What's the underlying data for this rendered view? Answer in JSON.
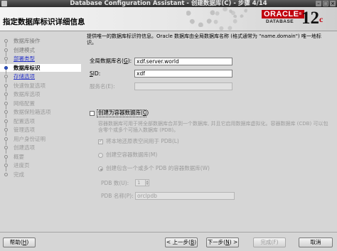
{
  "window": {
    "title": "Database Configuration Assistant - 创建数据库(C) - 步骤 4/14"
  },
  "header": {
    "page_title": "指定数据库标识详细信息",
    "brand_word": "ORACLE",
    "brand_registered": "®",
    "brand_sub": "DATABASE",
    "version_number": "12",
    "version_suffix": "c"
  },
  "steps": [
    {
      "label": "数据库操作",
      "state": "done"
    },
    {
      "label": "创建模式",
      "state": "done"
    },
    {
      "label": "部署类型",
      "state": "link"
    },
    {
      "label": "数据库标识",
      "state": "current"
    },
    {
      "label": "存储选项",
      "state": "link"
    },
    {
      "label": "快速恢复选项",
      "state": "pending"
    },
    {
      "label": "数据库选项",
      "state": "pending"
    },
    {
      "label": "网络配置",
      "state": "pending"
    },
    {
      "label": "数据保险箱选项",
      "state": "pending"
    },
    {
      "label": "配置选项",
      "state": "pending"
    },
    {
      "label": "管理选项",
      "state": "pending"
    },
    {
      "label": "用户身份证明",
      "state": "pending"
    },
    {
      "label": "创建选项",
      "state": "pending"
    },
    {
      "label": "概要",
      "state": "pending"
    },
    {
      "label": "进度页",
      "state": "pending"
    },
    {
      "label": "完成",
      "state": "pending"
    }
  ],
  "form": {
    "intro": "提供唯一的数据库标识符信息。Oracle 数据库由全局数据库名称 (格式通常为 \"name.domain\") 唯一地标识。",
    "global_db_name": {
      "label_before": "全局数据库名(",
      "mnemonic": "G",
      "label_after": "):",
      "value": "xdf.server.world"
    },
    "sid": {
      "mnemonic": "S",
      "label_after": "ID:",
      "value": "xdf"
    },
    "service_name": {
      "label": "服务名(E):",
      "value": ""
    },
    "container_db": {
      "label_before": "创建为容器数据库(",
      "mnemonic": "C",
      "label_after": ")",
      "checked": false
    },
    "container_desc": "容器数据库可用于将全部数据库合并到一个数据库, 并且它启用数据库虚拟化。容器数据库 (CDB) 可以包含零个或多个可插入数据库 (PDB)。",
    "undo_tablespace": {
      "label": "将本地还原表空间用于 PDB(L)",
      "checked": true
    },
    "empty_cdb": {
      "label": "创建空容器数据库(M)",
      "selected": false
    },
    "with_pdbs": {
      "label": "创建包含一个或多个 PDB 的容器数据库(W)",
      "selected": true
    },
    "pdb_count": {
      "label": "PDB 数(U):",
      "value": "1"
    },
    "pdb_name": {
      "label": "PDB 名称(P):",
      "value": "orclpdb"
    }
  },
  "buttons": {
    "help": {
      "label": "帮助(",
      "mnemonic": "H",
      "after": ")"
    },
    "back": {
      "label": "< 上一步(",
      "mnemonic": "B",
      "after": ")"
    },
    "next": {
      "label": "下一步(",
      "mnemonic": "N",
      "after": ") >"
    },
    "finish": {
      "label": "完成(F)"
    },
    "cancel": {
      "label": "取消"
    }
  }
}
